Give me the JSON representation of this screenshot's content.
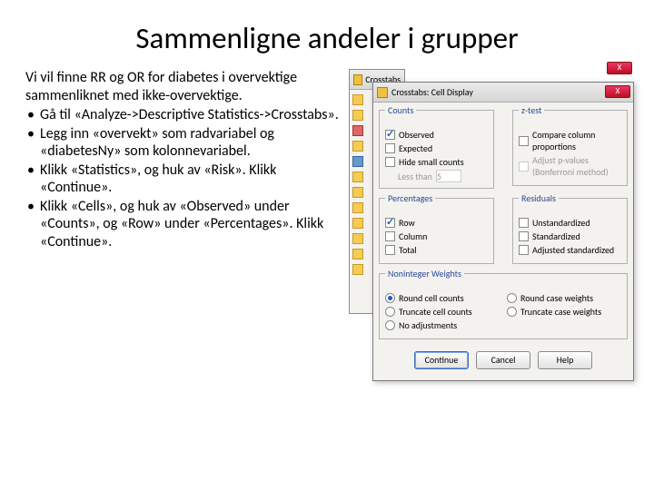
{
  "title": "Sammenligne andeler i grupper",
  "intro": "Vi vil finne RR og OR for diabetes i overvektige sammenliknet med ikke-overvektige.",
  "bullets": [
    "Gå til «Analyze->Descriptive Statistics->Crosstabs».",
    "Legg inn «overvekt» som radvariabel og «diabetesNy» som kolonnevariabel.",
    "Klikk «Statistics», og huk av «Risk». Klikk «Continue».",
    "Klikk «Cells», og huk av «Observed» under «Counts», og «Row» under «Percentages». Klikk «Continue»."
  ],
  "back_window": {
    "title": "Crosstabs"
  },
  "dialog": {
    "title": "Crosstabs: Cell Display",
    "close": "X",
    "groups": {
      "counts": {
        "title": "Counts",
        "observed": "Observed",
        "expected": "Expected",
        "hide": "Hide small counts",
        "lessthan": "Less than",
        "lessthan_val": "5"
      },
      "ztest": {
        "title": "z-test",
        "compare": "Compare column proportions",
        "adjust": "Adjust p-values (Bonferroni method)"
      },
      "percentages": {
        "title": "Percentages",
        "row": "Row",
        "column": "Column",
        "total": "Total"
      },
      "residuals": {
        "title": "Residuals",
        "unstd": "Unstandardized",
        "std": "Standardized",
        "adjstd": "Adjusted standardized"
      },
      "weights": {
        "title": "Noninteger Weights",
        "r1": "Round cell counts",
        "r2": "Round case weights",
        "r3": "Truncate cell counts",
        "r4": "Truncate case weights",
        "r5": "No adjustments"
      }
    },
    "buttons": {
      "continue": "Continue",
      "cancel": "Cancel",
      "help": "Help"
    }
  }
}
